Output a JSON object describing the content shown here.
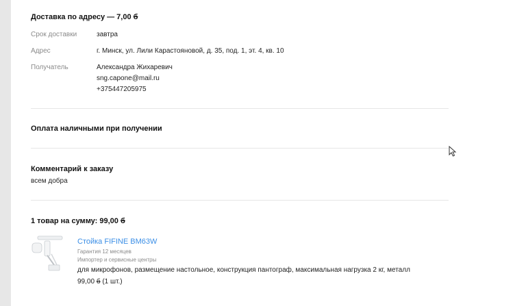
{
  "delivery": {
    "title": "Доставка по адресу — 7,00",
    "currency": "б",
    "rows": [
      {
        "label": "Срок доставки",
        "value": "завтра"
      },
      {
        "label": "Адрес",
        "value": "г. Минск, ул. Лили Карастояновой, д. 35, под. 1, эт. 4, кв. 10"
      },
      {
        "label": "Получатель",
        "lines": [
          "Александра Жихаревич",
          "sng.capone@mail.ru",
          "+375447205975"
        ]
      }
    ]
  },
  "payment": {
    "title": "Оплата наличными при получении"
  },
  "comment": {
    "title": "Комментарий к заказу",
    "text": "всем добра"
  },
  "order": {
    "summary": "1 товар на сумму: 99,00",
    "currency": "б",
    "item": {
      "name": "Стойка FIFINE BM63W",
      "warranty": "Гарантия 12 месяцев",
      "importer": "Импортер и сервисные центры",
      "description": "для микрофонов, размещение настольное, конструкция пантограф, максимальная нагрузка 2 кг, металл",
      "price": "99,00",
      "currency": "б",
      "qty": "(1 шт.)"
    }
  },
  "colors": {
    "link": "#3a8ee6",
    "muted": "#8a8a8a",
    "divider": "#e6e6e6",
    "rail": "#e7e7e7"
  }
}
